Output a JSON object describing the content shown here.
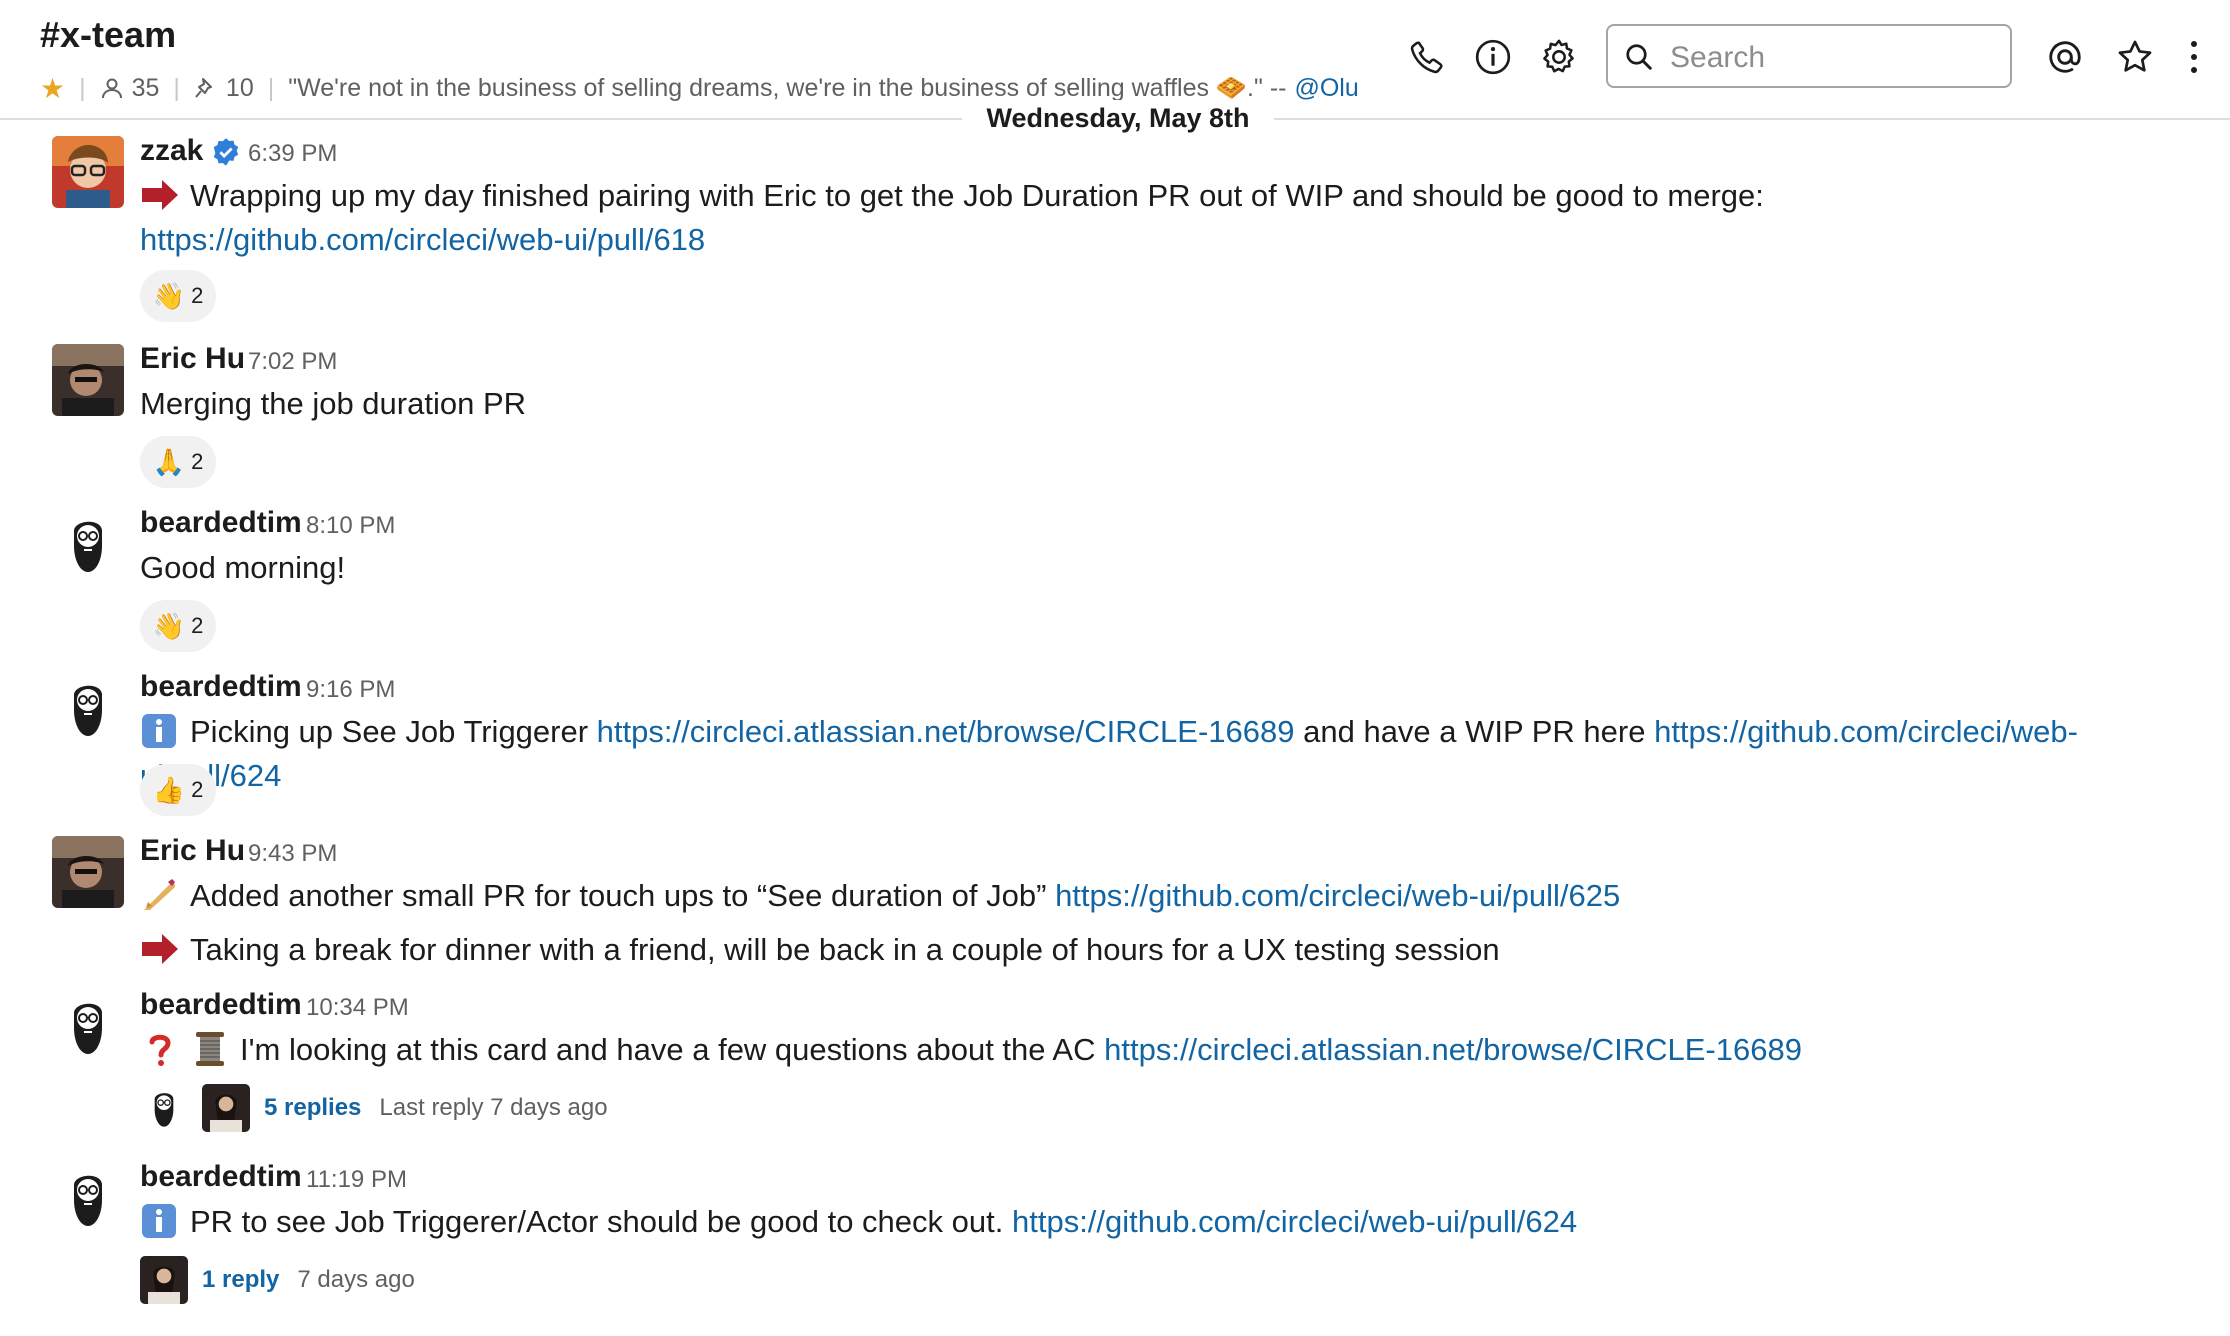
{
  "header": {
    "channel": "#x-team",
    "members": "35",
    "pins": "10",
    "topic": "\"We're not in the business of selling dreams, we're in the business of selling waffles 🧇.\" --",
    "topic_mention": "@Olu",
    "search_placeholder": "Search",
    "icons": [
      "star-icon",
      "person-icon",
      "pin-icon",
      "phone-icon",
      "info-icon",
      "gear-icon",
      "search-icon",
      "at-icon",
      "star-outline-icon",
      "more-icon"
    ],
    "colors": {
      "star": "#e8a723",
      "link": "#1264a3"
    }
  },
  "date_divider": "Wednesday, May 8th",
  "messages": [
    {
      "author": "zzak",
      "verified": true,
      "time": "6:39 PM",
      "lines": [
        {
          "emoji": "arrow-right-emoji",
          "text": "Wrapping up my day finished pairing with Eric to get the Job Duration PR out of WIP and should be good to merge:  ",
          "link": "https://github.com/circleci/web-ui/pull/618"
        }
      ],
      "reaction": {
        "emoji": "👋",
        "count": "2"
      }
    },
    {
      "author": "Eric Hu",
      "time": "7:02 PM",
      "lines": [
        {
          "text": "Merging the job duration PR"
        }
      ],
      "reaction": {
        "emoji": "🙏",
        "count": "2"
      }
    },
    {
      "author": "beardedtim",
      "time": "8:10 PM",
      "lines": [
        {
          "text": "Good morning!"
        }
      ],
      "reaction": {
        "emoji": "👋",
        "count": "2"
      }
    },
    {
      "author": "beardedtim",
      "time": "9:16 PM",
      "lines": [
        {
          "emoji": "info-emoji",
          "text": "Picking up See Job Triggerer ",
          "link": "https://circleci.atlassian.net/browse/CIRCLE-16689",
          "text2": " and have a WIP PR here ",
          "link2": "https://github.com/circleci/web-ui/pull/624"
        }
      ],
      "reaction": {
        "emoji": "👍",
        "count": "2"
      }
    },
    {
      "author": "Eric Hu",
      "time": "9:43 PM",
      "lines": [
        {
          "emoji": "nail-care-emoji",
          "text": "Added another small PR for touch ups to “See duration of Job”  ",
          "link": "https://github.com/circleci/web-ui/pull/625"
        },
        {
          "emoji": "arrow-right-emoji",
          "text": "Taking a break for dinner with a friend, will be back in a couple of hours for a UX testing session"
        }
      ]
    },
    {
      "author": "beardedtim",
      "time": "10:34 PM",
      "lines": [
        {
          "emoji": "question-emoji",
          "emoji2": "thread-spool-emoji",
          "text": "I'm looking at this card and have a few questions about the AC ",
          "link": "https://circleci.atlassian.net/browse/CIRCLE-16689"
        }
      ],
      "thread": {
        "replies": "5 replies",
        "last": "Last reply 7 days ago"
      }
    },
    {
      "author": "beardedtim",
      "time": "11:19 PM",
      "lines": [
        {
          "emoji": "info-emoji",
          "text": "PR to see Job Triggerer/Actor should be good to check out.  ",
          "link": "https://github.com/circleci/web-ui/pull/624"
        }
      ],
      "thread": {
        "replies": "1 reply",
        "last": "7 days ago"
      }
    }
  ]
}
